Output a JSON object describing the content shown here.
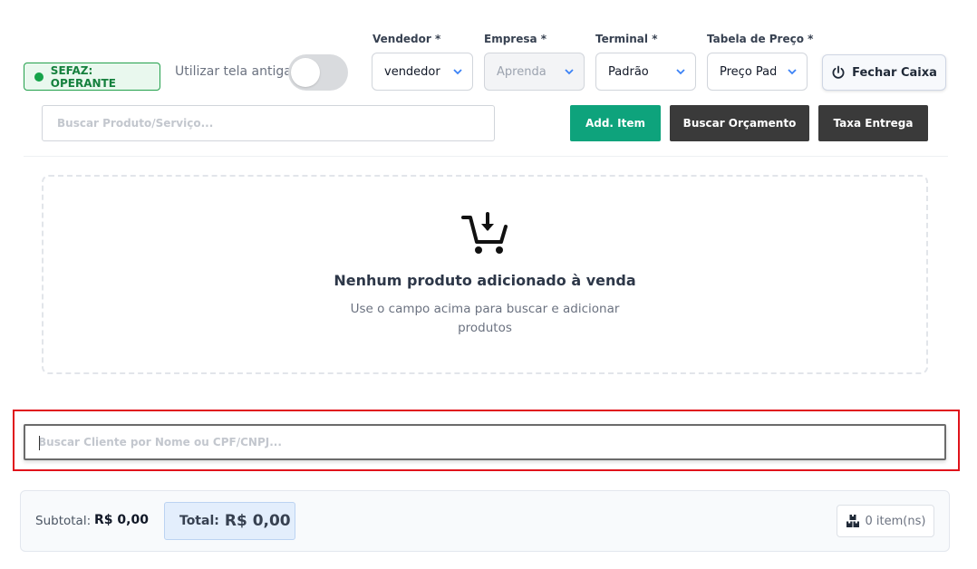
{
  "status": {
    "label": "SEFAZ: OPERANTE",
    "color": "#16a34a"
  },
  "old_screen": {
    "label": "Utilizar tela antiga",
    "enabled": false
  },
  "filters": {
    "vendedor": {
      "label": "Vendedor *",
      "value": "vendedor"
    },
    "empresa": {
      "label": "Empresa *",
      "value": "Aprenda E"
    },
    "terminal": {
      "label": "Terminal *",
      "value": "Padrão"
    },
    "tabela": {
      "label": "Tabela de Preço *",
      "value": "Preço Pad"
    }
  },
  "close_register": {
    "label": "Fechar Caixa",
    "icon": "power-icon"
  },
  "product_search": {
    "placeholder": "Buscar Produto/Serviço..."
  },
  "actions": {
    "add_item": "Add. Item",
    "search_quote": "Buscar Orçamento",
    "delivery_fee": "Taxa Entrega"
  },
  "empty_state": {
    "icon": "cart-download-icon",
    "title": "Nenhum produto adicionado à venda",
    "subtitle": "Use o campo acima para buscar e adicionar produtos"
  },
  "client_search": {
    "placeholder": "Buscar Cliente por Nome ou CPF/CNPJ..."
  },
  "summary": {
    "subtotal_label": "Subtotal:",
    "subtotal_value": "R$ 0,00",
    "total_label": "Total:",
    "total_value": "R$ 0,00",
    "items_count": "0 item(ns)",
    "items_icon": "boxes-icon"
  }
}
